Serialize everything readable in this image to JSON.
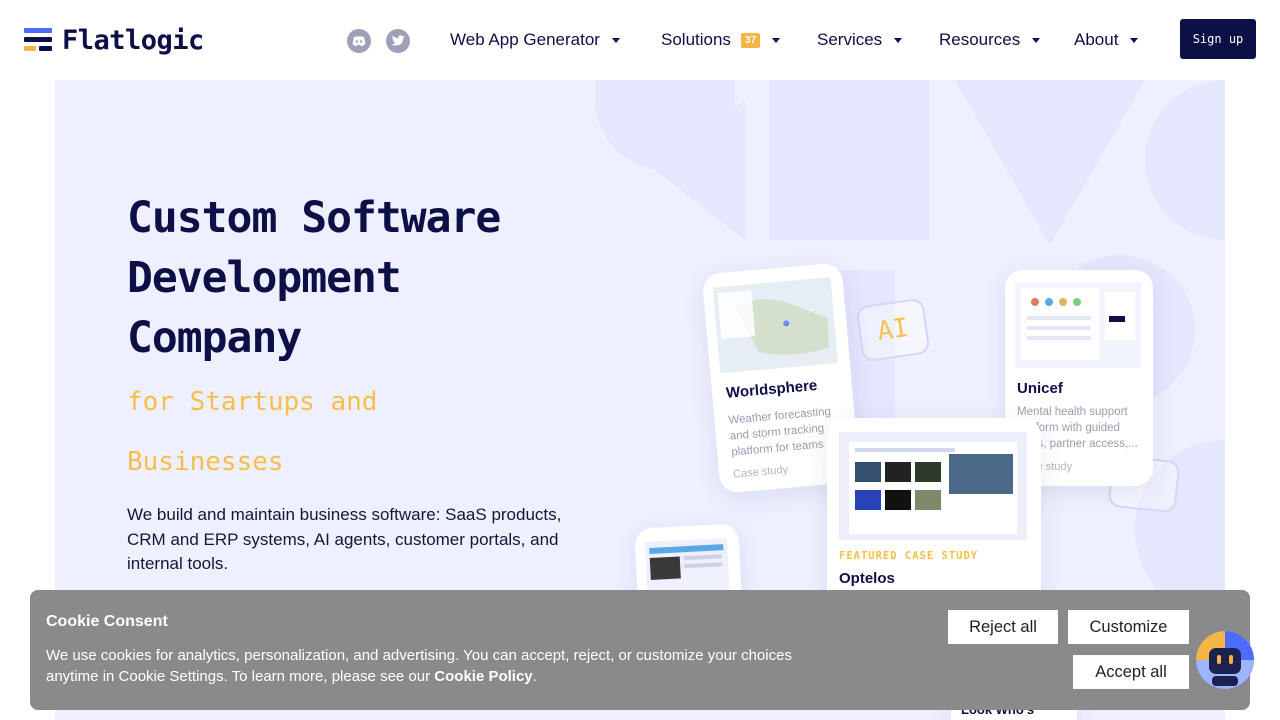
{
  "brand": {
    "name": "Flatlogic"
  },
  "header": {
    "social": [
      {
        "icon": "discord-icon"
      },
      {
        "icon": "twitter-icon"
      }
    ],
    "nav": [
      {
        "label": "Web App Generator"
      },
      {
        "label": "Solutions",
        "badge": "37"
      },
      {
        "label": "Services"
      },
      {
        "label": "Resources"
      },
      {
        "label": "About"
      }
    ],
    "signup_label": "Sign up"
  },
  "hero": {
    "title_lines": [
      "Custom Software",
      "Development",
      "Company"
    ],
    "subtitle_lines": [
      "for Startups and",
      "Businesses"
    ],
    "description": "We build and maintain business software: SaaS products, CRM and ERP systems, AI agents, customer portals, and internal tools."
  },
  "cards": {
    "worldsphere": {
      "title": "Worldsphere",
      "text": "Weather forecasting and storm tracking platform for teams",
      "tag": "Case study"
    },
    "unicef": {
      "title": "Unicef",
      "text": "Mental health support platform with guided flows, partner access,...",
      "tag": "Case study"
    },
    "optelos": {
      "featured": "FEATURED CASE STUDY",
      "title": "Optelos"
    },
    "chip_ai": "AI",
    "bottom_label": "Look Who's"
  },
  "cookie": {
    "title": "Cookie Consent",
    "text_main": "We use cookies for analytics, personalization, and advertising. You can accept, reject, or customize your choices anytime in Cookie Settings. To learn more, please see our",
    "policy_link": "Cookie Policy",
    "text_end": ".",
    "reject_label": "Reject all",
    "customize_label": "Customize",
    "accept_label": "Accept all"
  },
  "colors": {
    "navy": "#0d0f47",
    "accent_yellow": "#f5bf4a",
    "hero_bg": "#eef0ff",
    "logo_blue": "#4d6bff"
  }
}
